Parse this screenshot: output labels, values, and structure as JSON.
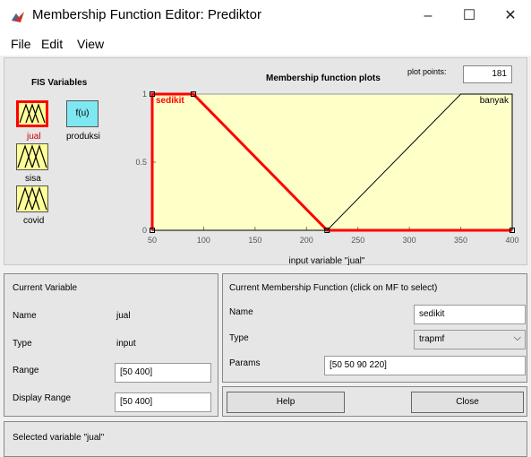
{
  "window": {
    "title": "Membership Function Editor: Prediktor",
    "minimize_glyph": "–",
    "maximize_glyph": "☐",
    "close_glyph": "✕"
  },
  "menu": {
    "items": [
      "File",
      "Edit",
      "View"
    ]
  },
  "fis": {
    "title": "FIS Variables",
    "inputs": [
      {
        "label": "jual",
        "selected": true,
        "color": "#cc0000"
      },
      {
        "label": "sisa",
        "selected": false,
        "color": "#000000"
      },
      {
        "label": "covid",
        "selected": false,
        "color": "#000000"
      }
    ],
    "output": {
      "label": "produksi",
      "icon_text": "f(u)"
    }
  },
  "plot": {
    "title": "Membership function plots",
    "points_label": "plot points:",
    "points_value": "181",
    "xlabel": "input variable \"jual\""
  },
  "chart_data": {
    "type": "line",
    "xlim": [
      50,
      400
    ],
    "ylim": [
      0,
      1
    ],
    "xticks": [
      50,
      100,
      150,
      200,
      250,
      300,
      350,
      400
    ],
    "yticks": [
      0,
      0.5,
      1
    ],
    "xlabel": "input variable \"jual\"",
    "series": [
      {
        "name": "sedikit",
        "color": "#ff0000",
        "selected": true,
        "x": [
          50,
          50,
          90,
          220,
          400
        ],
        "y": [
          0,
          1,
          1,
          0,
          0
        ]
      },
      {
        "name": "banyak",
        "color": "#000000",
        "selected": false,
        "x": [
          50,
          220,
          350,
          400,
          400
        ],
        "y": [
          0,
          0,
          1,
          1,
          0
        ]
      }
    ]
  },
  "current_variable": {
    "title": "Current Variable",
    "name_label": "Name",
    "name_value": "jual",
    "type_label": "Type",
    "type_value": "input",
    "range_label": "Range",
    "range_value": "[50 400]",
    "display_range_label": "Display Range",
    "display_range_value": "[50 400]"
  },
  "current_mf": {
    "title": "Current Membership Function (click on MF to select)",
    "name_label": "Name",
    "name_value": "sedikit",
    "type_label": "Type",
    "type_value": "trapmf",
    "params_label": "Params",
    "params_value": "[50 50 90 220]"
  },
  "buttons": {
    "help": "Help",
    "close": "Close"
  },
  "status": "Selected variable \"jual\""
}
